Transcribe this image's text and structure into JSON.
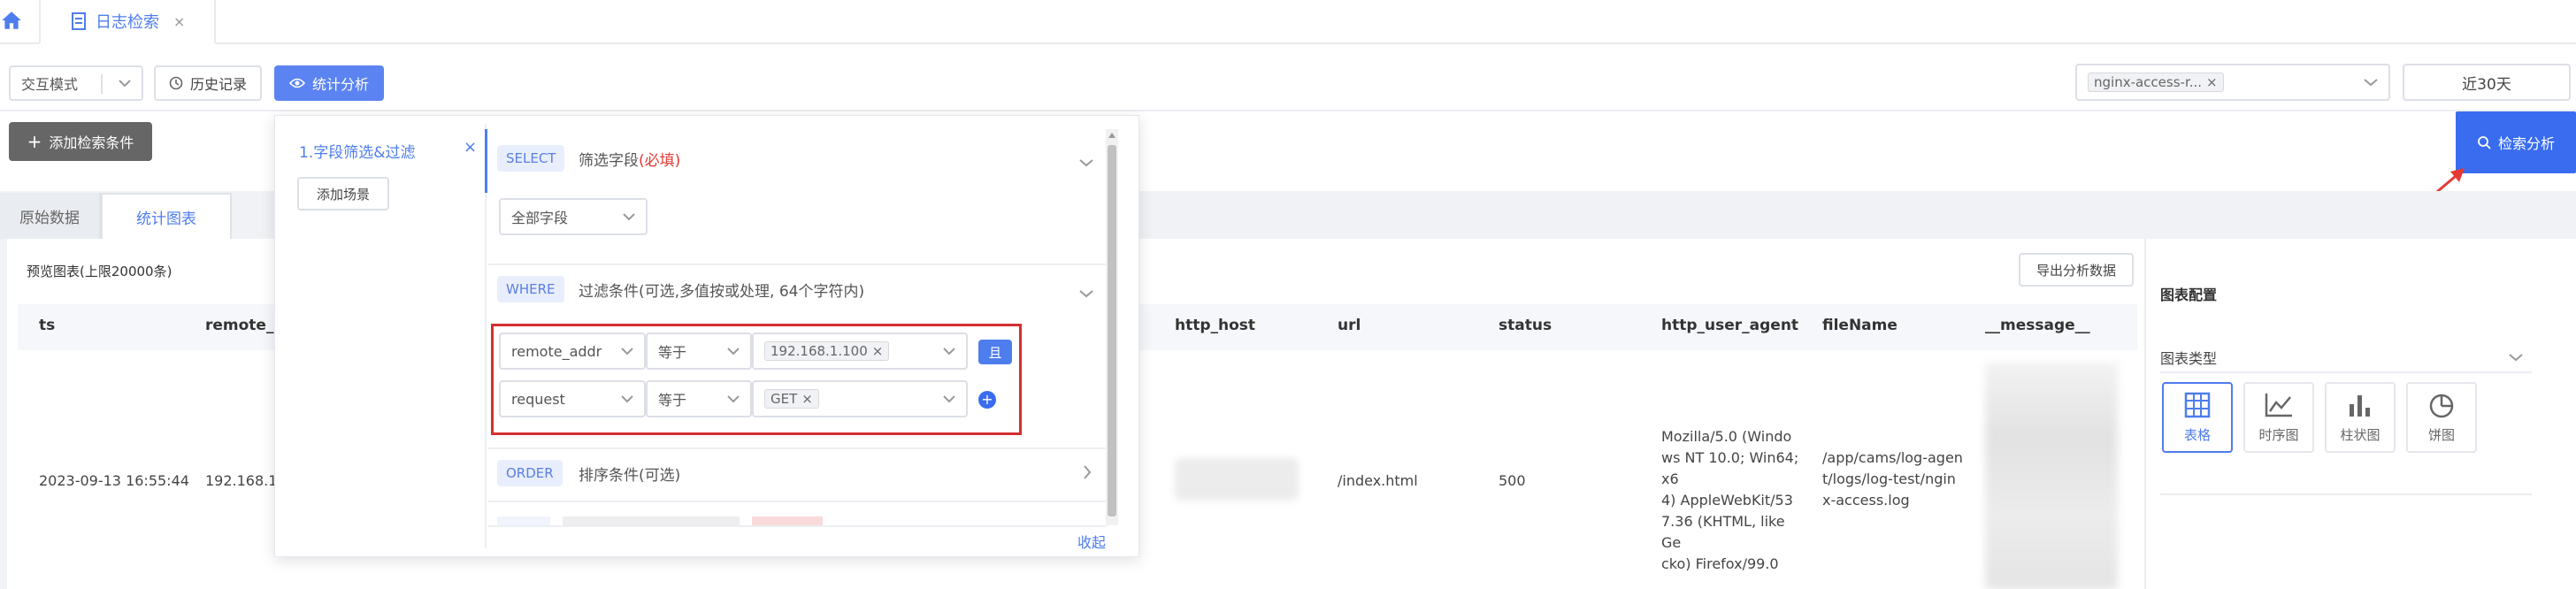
{
  "tabs": {
    "active": "日志检索"
  },
  "toolbar": {
    "mode": "交互模式",
    "history": "历史记录",
    "stats": "统计分析",
    "add_condition": "添加检索条件",
    "source": "nginx-access-r...",
    "time_range": "近30天",
    "search": "检索分析"
  },
  "view_tabs": {
    "raw": "原始数据",
    "chart": "统计图表"
  },
  "preview_label": "预览图表(上限20000条)",
  "export_label": "导出分析数据",
  "table": {
    "columns": [
      "ts",
      "remote_a",
      "http_host",
      "url",
      "status",
      "http_user_agent",
      "fileName",
      "__message__"
    ],
    "row": {
      "ts": "2023-09-13 16:55:44",
      "remote": "192.168.1.",
      "url": "/index.html",
      "status": "500",
      "ua": [
        "Mozilla/5.0 (Windo",
        "ws NT 10.0; Win64; x6",
        "4) AppleWebKit/53",
        "7.36 (KHTML, like Ge",
        "cko) Firefox/99.0"
      ],
      "file": [
        "/app/cams/log-agen",
        "t/logs/log-test/ngin",
        "x-access.log"
      ]
    }
  },
  "chart_config": {
    "title": "图表配置",
    "type_label": "图表类型",
    "types": [
      "表格",
      "时序图",
      "柱状图",
      "饼图"
    ]
  },
  "panel": {
    "scene": "1.字段筛选&过滤",
    "add_scene": "添加场景",
    "select_kw": "SELECT",
    "select_text": "筛选字段",
    "select_required": "(必填)",
    "all_fields": "全部字段",
    "where_kw": "WHERE",
    "where_text": "过滤条件(可选,多值按或处理, 64个字符内)",
    "cond1": {
      "field": "remote_addr",
      "op": "等于",
      "value": "192.168.1.100",
      "logic": "且"
    },
    "cond2": {
      "field": "request",
      "op": "等于",
      "value": "GET"
    },
    "order_kw": "ORDER",
    "order_text": "排序条件(可选)",
    "collapse": "收起"
  },
  "colors": {
    "primary": "#4e7ded",
    "danger": "#e53935",
    "accent_red": "#d32f2f"
  }
}
